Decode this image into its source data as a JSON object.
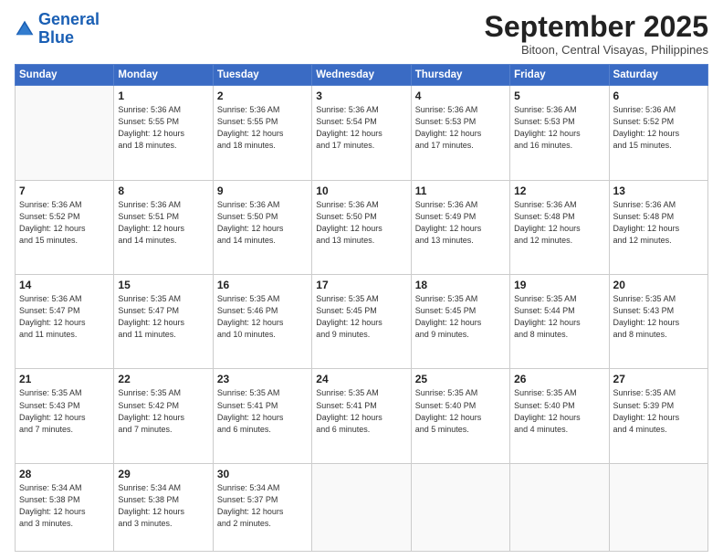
{
  "header": {
    "logo_line1": "General",
    "logo_line2": "Blue",
    "month_title": "September 2025",
    "subtitle": "Bitoon, Central Visayas, Philippines"
  },
  "weekdays": [
    "Sunday",
    "Monday",
    "Tuesday",
    "Wednesday",
    "Thursday",
    "Friday",
    "Saturday"
  ],
  "weeks": [
    [
      {
        "day": "",
        "info": ""
      },
      {
        "day": "1",
        "info": "Sunrise: 5:36 AM\nSunset: 5:55 PM\nDaylight: 12 hours\nand 18 minutes."
      },
      {
        "day": "2",
        "info": "Sunrise: 5:36 AM\nSunset: 5:55 PM\nDaylight: 12 hours\nand 18 minutes."
      },
      {
        "day": "3",
        "info": "Sunrise: 5:36 AM\nSunset: 5:54 PM\nDaylight: 12 hours\nand 17 minutes."
      },
      {
        "day": "4",
        "info": "Sunrise: 5:36 AM\nSunset: 5:53 PM\nDaylight: 12 hours\nand 17 minutes."
      },
      {
        "day": "5",
        "info": "Sunrise: 5:36 AM\nSunset: 5:53 PM\nDaylight: 12 hours\nand 16 minutes."
      },
      {
        "day": "6",
        "info": "Sunrise: 5:36 AM\nSunset: 5:52 PM\nDaylight: 12 hours\nand 15 minutes."
      }
    ],
    [
      {
        "day": "7",
        "info": "Sunrise: 5:36 AM\nSunset: 5:52 PM\nDaylight: 12 hours\nand 15 minutes."
      },
      {
        "day": "8",
        "info": "Sunrise: 5:36 AM\nSunset: 5:51 PM\nDaylight: 12 hours\nand 14 minutes."
      },
      {
        "day": "9",
        "info": "Sunrise: 5:36 AM\nSunset: 5:50 PM\nDaylight: 12 hours\nand 14 minutes."
      },
      {
        "day": "10",
        "info": "Sunrise: 5:36 AM\nSunset: 5:50 PM\nDaylight: 12 hours\nand 13 minutes."
      },
      {
        "day": "11",
        "info": "Sunrise: 5:36 AM\nSunset: 5:49 PM\nDaylight: 12 hours\nand 13 minutes."
      },
      {
        "day": "12",
        "info": "Sunrise: 5:36 AM\nSunset: 5:48 PM\nDaylight: 12 hours\nand 12 minutes."
      },
      {
        "day": "13",
        "info": "Sunrise: 5:36 AM\nSunset: 5:48 PM\nDaylight: 12 hours\nand 12 minutes."
      }
    ],
    [
      {
        "day": "14",
        "info": "Sunrise: 5:36 AM\nSunset: 5:47 PM\nDaylight: 12 hours\nand 11 minutes."
      },
      {
        "day": "15",
        "info": "Sunrise: 5:35 AM\nSunset: 5:47 PM\nDaylight: 12 hours\nand 11 minutes."
      },
      {
        "day": "16",
        "info": "Sunrise: 5:35 AM\nSunset: 5:46 PM\nDaylight: 12 hours\nand 10 minutes."
      },
      {
        "day": "17",
        "info": "Sunrise: 5:35 AM\nSunset: 5:45 PM\nDaylight: 12 hours\nand 9 minutes."
      },
      {
        "day": "18",
        "info": "Sunrise: 5:35 AM\nSunset: 5:45 PM\nDaylight: 12 hours\nand 9 minutes."
      },
      {
        "day": "19",
        "info": "Sunrise: 5:35 AM\nSunset: 5:44 PM\nDaylight: 12 hours\nand 8 minutes."
      },
      {
        "day": "20",
        "info": "Sunrise: 5:35 AM\nSunset: 5:43 PM\nDaylight: 12 hours\nand 8 minutes."
      }
    ],
    [
      {
        "day": "21",
        "info": "Sunrise: 5:35 AM\nSunset: 5:43 PM\nDaylight: 12 hours\nand 7 minutes."
      },
      {
        "day": "22",
        "info": "Sunrise: 5:35 AM\nSunset: 5:42 PM\nDaylight: 12 hours\nand 7 minutes."
      },
      {
        "day": "23",
        "info": "Sunrise: 5:35 AM\nSunset: 5:41 PM\nDaylight: 12 hours\nand 6 minutes."
      },
      {
        "day": "24",
        "info": "Sunrise: 5:35 AM\nSunset: 5:41 PM\nDaylight: 12 hours\nand 6 minutes."
      },
      {
        "day": "25",
        "info": "Sunrise: 5:35 AM\nSunset: 5:40 PM\nDaylight: 12 hours\nand 5 minutes."
      },
      {
        "day": "26",
        "info": "Sunrise: 5:35 AM\nSunset: 5:40 PM\nDaylight: 12 hours\nand 4 minutes."
      },
      {
        "day": "27",
        "info": "Sunrise: 5:35 AM\nSunset: 5:39 PM\nDaylight: 12 hours\nand 4 minutes."
      }
    ],
    [
      {
        "day": "28",
        "info": "Sunrise: 5:34 AM\nSunset: 5:38 PM\nDaylight: 12 hours\nand 3 minutes."
      },
      {
        "day": "29",
        "info": "Sunrise: 5:34 AM\nSunset: 5:38 PM\nDaylight: 12 hours\nand 3 minutes."
      },
      {
        "day": "30",
        "info": "Sunrise: 5:34 AM\nSunset: 5:37 PM\nDaylight: 12 hours\nand 2 minutes."
      },
      {
        "day": "",
        "info": ""
      },
      {
        "day": "",
        "info": ""
      },
      {
        "day": "",
        "info": ""
      },
      {
        "day": "",
        "info": ""
      }
    ]
  ]
}
